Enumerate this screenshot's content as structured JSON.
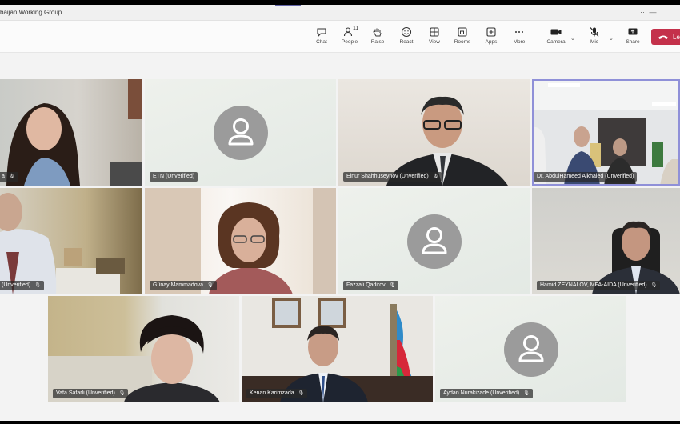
{
  "window": {
    "title": "baijan Working Group",
    "controls": "···  —"
  },
  "toolbar": {
    "chat": "Chat",
    "people": "People",
    "people_count": "11",
    "raise": "Raise",
    "react": "React",
    "view": "View",
    "rooms": "Rooms",
    "apps": "Apps",
    "more": "More",
    "camera": "Camera",
    "mic": "Mic",
    "share": "Share",
    "leave": "Le"
  },
  "participants": [
    {
      "name": "a",
      "verified": "",
      "video": true
    },
    {
      "name": "ETN (Unverified)",
      "video": false
    },
    {
      "name": "Elnur Shahhuseynov (Unverified)",
      "video": true
    },
    {
      "name": "Dr. AbdulHameed Alkhaled (Unverified)",
      "video": true,
      "active": true
    },
    {
      "name": "(Unverified)",
      "video": true
    },
    {
      "name": "Günay Mammadova",
      "video": true
    },
    {
      "name": "Fazzali Qadirov",
      "video": false
    },
    {
      "name": "Hamid ZEYNALOV, MFA-AIDA (Unverified)",
      "video": true
    },
    {
      "name": "Vafa Safarli (Unverified)",
      "video": true
    },
    {
      "name": "Kenan Karimzada",
      "video": true
    },
    {
      "name": "Aydan Nurakizade (Unverified)",
      "video": false
    }
  ]
}
